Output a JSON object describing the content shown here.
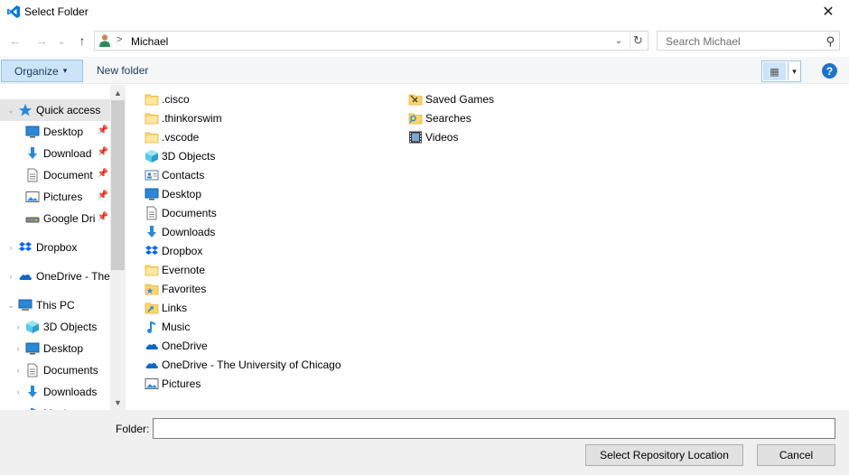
{
  "window": {
    "title": "Select Folder",
    "close_glyph": "✕"
  },
  "nav": {
    "back_glyph": "←",
    "forward_glyph": "→",
    "recent_glyph": "⌄",
    "up_glyph": "↑",
    "breadcrumb_sep": ">",
    "breadcrumb": "Michael",
    "dropdown_glyph": "⌄",
    "refresh_glyph": "↻",
    "search_placeholder": "Search Michael",
    "search_glyph": "⚲"
  },
  "toolbar": {
    "organize_label": "Organize",
    "organize_caret": "▾",
    "new_folder_label": "New folder",
    "view_glyph": "▦",
    "view_dropdown_glyph": "▾",
    "help_label": "?"
  },
  "sidebar": {
    "scroll_up": "▲",
    "scroll_down": "▼",
    "items": [
      {
        "label": "Quick access",
        "icon": "star-icon",
        "chev": "⌄",
        "pinned": false
      },
      {
        "label": "Desktop",
        "icon": "desktop-icon",
        "chev": "",
        "pinned": true
      },
      {
        "label": "Download",
        "icon": "download-icon",
        "chev": "",
        "pinned": true
      },
      {
        "label": "Document",
        "icon": "document-icon",
        "chev": "",
        "pinned": true
      },
      {
        "label": "Pictures",
        "icon": "pictures-icon",
        "chev": "",
        "pinned": true
      },
      {
        "label": "Google Dri",
        "icon": "drive-icon",
        "chev": "",
        "pinned": true
      },
      {
        "label": "Dropbox",
        "icon": "dropbox-icon",
        "chev": "›",
        "pinned": false
      },
      {
        "label": "OneDrive - The",
        "icon": "onedrive-icon",
        "chev": "›",
        "pinned": false
      },
      {
        "label": "This PC",
        "icon": "computer-icon",
        "chev": "⌄",
        "pinned": false
      },
      {
        "label": "3D Objects",
        "icon": "3d-objects-icon",
        "chev": "›",
        "pinned": false
      },
      {
        "label": "Desktop",
        "icon": "desktop-icon",
        "chev": "›",
        "pinned": false
      },
      {
        "label": "Documents",
        "icon": "document-icon",
        "chev": "›",
        "pinned": false
      },
      {
        "label": "Downloads",
        "icon": "download-icon",
        "chev": "›",
        "pinned": false
      },
      {
        "label": "Music",
        "icon": "music-icon",
        "chev": "›",
        "pinned": false
      }
    ],
    "pin_glyph": "📌"
  },
  "files": {
    "column1": [
      {
        "label": ".cisco",
        "icon": "folder-icon"
      },
      {
        "label": ".thinkorswim",
        "icon": "folder-icon"
      },
      {
        "label": ".vscode",
        "icon": "folder-icon"
      },
      {
        "label": "3D Objects",
        "icon": "3d-objects-icon"
      },
      {
        "label": "Contacts",
        "icon": "contacts-icon"
      },
      {
        "label": "Desktop",
        "icon": "desktop-icon"
      },
      {
        "label": "Documents",
        "icon": "document-icon"
      },
      {
        "label": "Downloads",
        "icon": "download-icon"
      },
      {
        "label": "Dropbox",
        "icon": "dropbox-icon"
      },
      {
        "label": "Evernote",
        "icon": "folder-icon"
      },
      {
        "label": "Favorites",
        "icon": "favorites-icon"
      },
      {
        "label": "Links",
        "icon": "links-icon"
      },
      {
        "label": "Music",
        "icon": "music-icon"
      },
      {
        "label": "OneDrive",
        "icon": "onedrive-icon"
      },
      {
        "label": "OneDrive - The University of Chicago",
        "icon": "onedrive-icon"
      },
      {
        "label": "Pictures",
        "icon": "pictures-icon"
      }
    ],
    "column2": [
      {
        "label": "Saved Games",
        "icon": "saved-games-icon"
      },
      {
        "label": "Searches",
        "icon": "searches-icon"
      },
      {
        "label": "Videos",
        "icon": "videos-icon"
      }
    ]
  },
  "footer": {
    "folder_label": "Folder:",
    "folder_value": "",
    "select_button": "Select Repository Location",
    "cancel_button": "Cancel"
  },
  "colors": {
    "accent": "#cce4f7",
    "accent_border": "#9ac3e6",
    "help_blue": "#1e73c8",
    "vscode_blue": "#0078d4",
    "folder_yellow": "#ffe19b"
  }
}
